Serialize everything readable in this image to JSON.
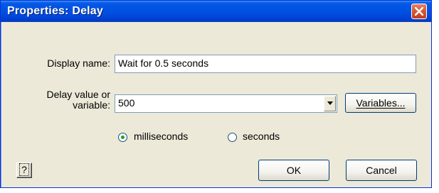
{
  "window": {
    "title": "Properties: Delay"
  },
  "form": {
    "display_name_label": "Display name:",
    "display_name_value": "Wait for 0.5 seconds",
    "delay_label_line1": "Delay value or",
    "delay_label_line2": "variable:",
    "delay_value": "500",
    "variables_button": "Variables...",
    "unit_options": [
      {
        "label": "milliseconds",
        "selected": true
      },
      {
        "label": "seconds",
        "selected": false
      }
    ]
  },
  "buttons": {
    "help": "?",
    "ok": "OK",
    "cancel": "Cancel"
  },
  "colors": {
    "titlebar": "#0055e5",
    "dialog_bg": "#ece9d8",
    "close_button": "#d65a36"
  }
}
